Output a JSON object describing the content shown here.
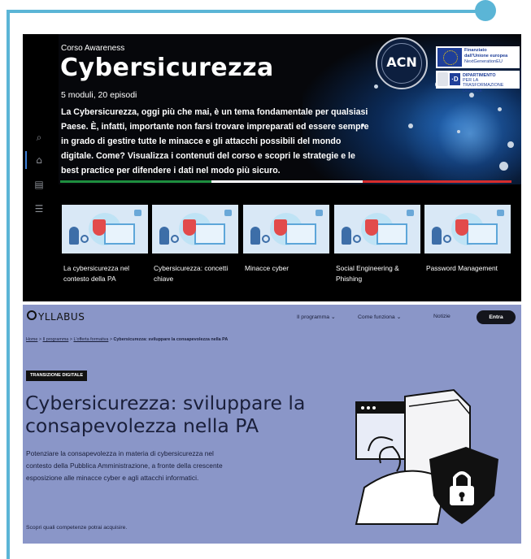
{
  "course": {
    "kicker": "Corso Awareness",
    "title": "Cybersicurezza",
    "meta": "5 moduli, 20 episodi",
    "description": "La Cybersicurezza, oggi più che mai, è un tema fondamentale per qualsiasi Paese. È, infatti, importante non farsi trovare impreparati ed essere sempre in grado di gestire tutte le minacce e gli attacchi possibili del mondo digitale. Come? Visualizza i contenuti del corso e scopri le strategie e le best practice per difendere i dati nel modo più sicuro."
  },
  "logos": {
    "acn": "ACN",
    "eu_line1": "Finanziato",
    "eu_line2": "dall'Unione europea",
    "eu_line3": "NextGenerationEU",
    "dtd_line1": "DIPARTIMENTO",
    "dtd_line2": "PER LA TRASFORMAZIONE",
    "dtd_line3": "DIGITALE",
    "dtd_mark": "·D"
  },
  "modules": [
    {
      "title": "La cybersicurezza nel contesto della PA"
    },
    {
      "title": "Cybersicurezza: concetti chiave"
    },
    {
      "title": "Minacce cyber"
    },
    {
      "title": "Social Engineering & Phishing"
    },
    {
      "title": "Password Management"
    }
  ],
  "syllabus": {
    "logo": "YLLABUS",
    "nav": [
      "Il programma ⌄",
      "Come funziona ⌄",
      "Notizie"
    ],
    "enter": "Entra",
    "breadcrumb": {
      "home": "Home",
      "sep": " > ",
      "programma": "Il programma",
      "offerta": "L'offerta formativa",
      "current": "Cybersicurezza: sviluppare la consapevolezza nella PA"
    },
    "tag": "TRANSIZIONE DIGITALE",
    "title": "Cybersicurezza: sviluppare la consapevolezza nella PA",
    "description": "Potenziare la consapevolezza in materia di cybersicurezza nel contesto della Pubblica Amministrazione, a fronte della crescente esposizione alle minacce cyber e agli attacchi informatici.",
    "skills_link": "Scopri quali competenze potrai acquisire."
  },
  "colors": {
    "frame": "#5bb5d6",
    "hero_bg": "#000000",
    "syllabus_bg": "#8a96c8",
    "accent_blue": "#3d7fd6"
  },
  "icons": {
    "rail": [
      "search-icon",
      "home-icon",
      "catalog-icon",
      "menu-icon"
    ]
  }
}
